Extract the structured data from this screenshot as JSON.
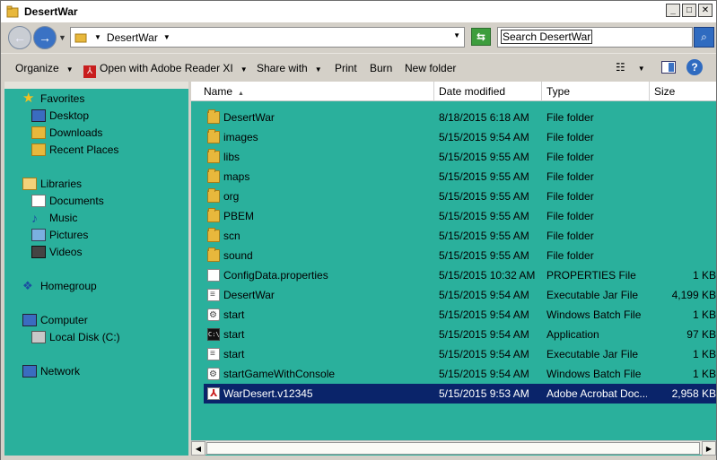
{
  "window": {
    "title": "DesertWar"
  },
  "address": {
    "path": [
      "DesertWar"
    ],
    "search_placeholder": "Search DesertWar"
  },
  "toolbar": {
    "organize": "Organize",
    "open_with": "Open with Adobe Reader XI",
    "share_with": "Share with",
    "print": "Print",
    "burn": "Burn",
    "new_folder": "New folder"
  },
  "nav": {
    "favorites": "Favorites",
    "desktop": "Desktop",
    "downloads": "Downloads",
    "recent": "Recent Places",
    "libraries": "Libraries",
    "documents": "Documents",
    "music": "Music",
    "pictures": "Pictures",
    "videos": "Videos",
    "homegroup": "Homegroup",
    "computer": "Computer",
    "local_disk": "Local Disk (C:)",
    "network": "Network"
  },
  "columns": {
    "name": "Name",
    "date": "Date modified",
    "type": "Type",
    "size": "Size"
  },
  "files": [
    {
      "name": "DesertWar",
      "date": "8/18/2015 6:18 AM",
      "type": "File folder",
      "size": "",
      "icon": "folder"
    },
    {
      "name": "images",
      "date": "5/15/2015 9:54 AM",
      "type": "File folder",
      "size": "",
      "icon": "folder"
    },
    {
      "name": "libs",
      "date": "5/15/2015 9:55 AM",
      "type": "File folder",
      "size": "",
      "icon": "folder"
    },
    {
      "name": "maps",
      "date": "5/15/2015 9:55 AM",
      "type": "File folder",
      "size": "",
      "icon": "folder"
    },
    {
      "name": "org",
      "date": "5/15/2015 9:55 AM",
      "type": "File folder",
      "size": "",
      "icon": "folder"
    },
    {
      "name": "PBEM",
      "date": "5/15/2015 9:55 AM",
      "type": "File folder",
      "size": "",
      "icon": "folder"
    },
    {
      "name": "scn",
      "date": "5/15/2015 9:55 AM",
      "type": "File folder",
      "size": "",
      "icon": "folder"
    },
    {
      "name": "sound",
      "date": "5/15/2015 9:55 AM",
      "type": "File folder",
      "size": "",
      "icon": "folder"
    },
    {
      "name": "ConfigData.properties",
      "date": "5/15/2015 10:32 AM",
      "type": "PROPERTIES File",
      "size": "1 KB",
      "icon": "file"
    },
    {
      "name": "DesertWar",
      "date": "5/15/2015 9:54 AM",
      "type": "Executable Jar File",
      "size": "4,199 KB",
      "icon": "jar"
    },
    {
      "name": "start",
      "date": "5/15/2015 9:54 AM",
      "type": "Windows Batch File",
      "size": "1 KB",
      "icon": "bat"
    },
    {
      "name": "start",
      "date": "5/15/2015 9:54 AM",
      "type": "Application",
      "size": "97 KB",
      "icon": "app"
    },
    {
      "name": "start",
      "date": "5/15/2015 9:54 AM",
      "type": "Executable Jar File",
      "size": "1 KB",
      "icon": "jar"
    },
    {
      "name": "startGameWithConsole",
      "date": "5/15/2015 9:54 AM",
      "type": "Windows Batch File",
      "size": "1 KB",
      "icon": "bat"
    },
    {
      "name": "WarDesert.v12345",
      "date": "5/15/2015 9:53 AM",
      "type": "Adobe Acrobat Doc...",
      "size": "2,958 KB",
      "icon": "pdf",
      "selected": true
    }
  ],
  "colors": {
    "pane_bg": "#2ab09c",
    "selection": "#0a246a"
  }
}
